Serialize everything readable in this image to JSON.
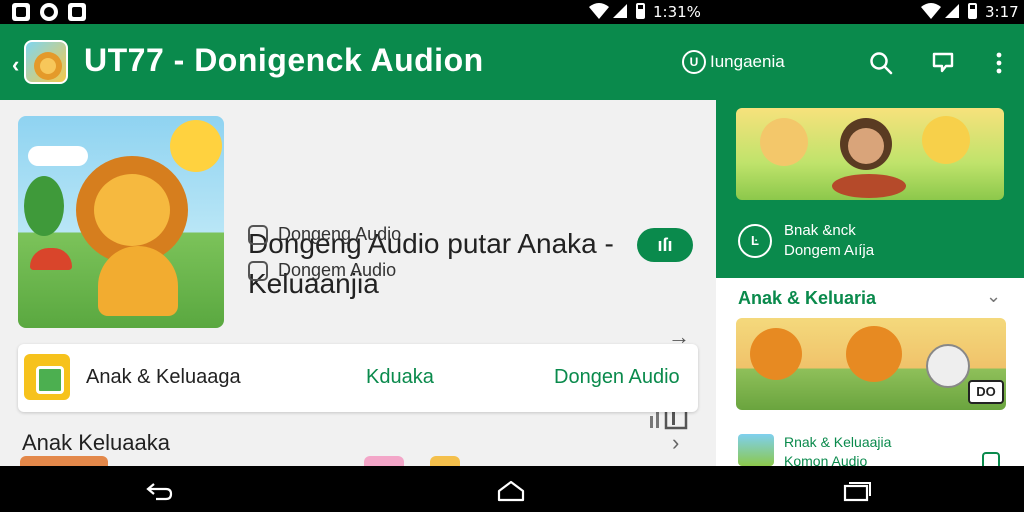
{
  "status_bar": {
    "time_center": "1:31%",
    "time_right": "3:17"
  },
  "app_bar": {
    "title": "UT77  -  Donigenck Audion",
    "language_label": "Iungaenia",
    "language_icon_text": "U",
    "icons": [
      "back-icon",
      "search-icon",
      "bookmark-icon",
      "more-vert-icon"
    ]
  },
  "hero": {
    "title": "Dongeng Audio putar Anaka - Keluaanjia",
    "badge": "ıſı",
    "meta_1": "Dongeng Audio",
    "meta_2": "Dongem Audio"
  },
  "tabs": {
    "item_1": "Anak & Keluaaga",
    "item_2": "Kduaka",
    "item_3": "Dongen Audio"
  },
  "section": {
    "title": "Anak Keluaaka"
  },
  "right_panel": {
    "card_icon_text": "Ŀ",
    "card_line_1": "Bnak &nck",
    "card_line_2": "Dongem Aıíja",
    "section_title": "Anak & Keluaria",
    "image_label": "DO",
    "item_line_1": "Rnak & Keluaajia",
    "item_line_2": "Komon Audio"
  },
  "colors": {
    "brand_green": "#0a8a4c",
    "background": "#f1f1f1",
    "text_dark": "#222222"
  }
}
